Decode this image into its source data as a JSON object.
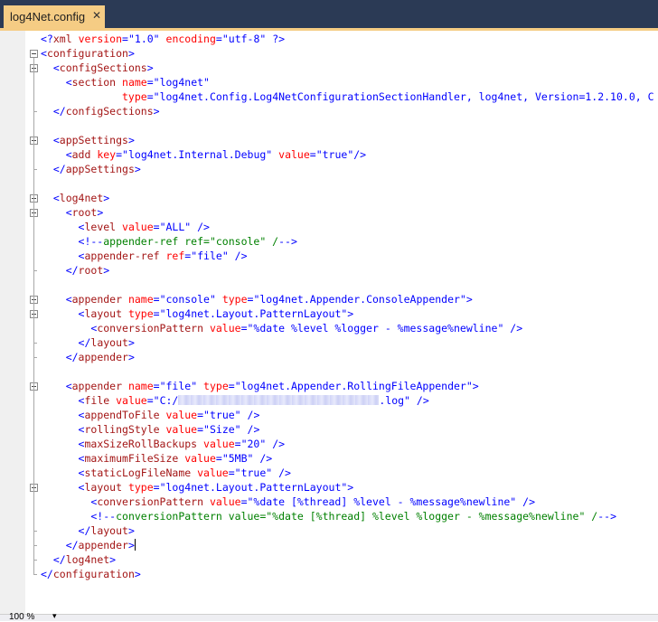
{
  "tab": {
    "title": "log4Net.config",
    "close_glyph": "✕"
  },
  "status": {
    "zoom": "100 %",
    "zoom_arrow": "▾"
  },
  "lines": [
    [
      [
        "b",
        "<?"
      ],
      [
        "t",
        "xml"
      ],
      [
        "a",
        " version"
      ],
      [
        "b",
        "="
      ],
      [
        "v",
        "\"1.0\""
      ],
      [
        "a",
        " encoding"
      ],
      [
        "b",
        "="
      ],
      [
        "v",
        "\"utf-8\""
      ],
      [
        "b",
        " ?>"
      ]
    ],
    [
      [
        "b",
        "<"
      ],
      [
        "t",
        "configuration"
      ],
      [
        "b",
        ">"
      ]
    ],
    [
      [
        "b",
        "  <"
      ],
      [
        "t",
        "configSections"
      ],
      [
        "b",
        ">"
      ]
    ],
    [
      [
        "b",
        "    <"
      ],
      [
        "t",
        "section"
      ],
      [
        "a",
        " name"
      ],
      [
        "b",
        "="
      ],
      [
        "v",
        "\"log4net\""
      ]
    ],
    [
      [
        "a",
        "             type"
      ],
      [
        "b",
        "="
      ],
      [
        "v",
        "\"log4net.Config.Log4NetConfigurationSectionHandler, log4net, Version=1.2.10.0, C"
      ]
    ],
    [
      [
        "b",
        "  </"
      ],
      [
        "t",
        "configSections"
      ],
      [
        "b",
        ">"
      ]
    ],
    [],
    [
      [
        "b",
        "  <"
      ],
      [
        "t",
        "appSettings"
      ],
      [
        "b",
        ">"
      ]
    ],
    [
      [
        "b",
        "    <"
      ],
      [
        "t",
        "add"
      ],
      [
        "a",
        " key"
      ],
      [
        "b",
        "="
      ],
      [
        "v",
        "\"log4net.Internal.Debug\""
      ],
      [
        "a",
        " value"
      ],
      [
        "b",
        "="
      ],
      [
        "v",
        "\"true\""
      ],
      [
        "b",
        "/>"
      ]
    ],
    [
      [
        "b",
        "  </"
      ],
      [
        "t",
        "appSettings"
      ],
      [
        "b",
        ">"
      ]
    ],
    [],
    [
      [
        "b",
        "  <"
      ],
      [
        "t",
        "log4net"
      ],
      [
        "b",
        ">"
      ]
    ],
    [
      [
        "b",
        "    <"
      ],
      [
        "t",
        "root"
      ],
      [
        "b",
        ">"
      ]
    ],
    [
      [
        "b",
        "      <"
      ],
      [
        "t",
        "level"
      ],
      [
        "a",
        " value"
      ],
      [
        "b",
        "="
      ],
      [
        "v",
        "\"ALL\""
      ],
      [
        "b",
        " />"
      ]
    ],
    [
      [
        "b",
        "      <!--"
      ],
      [
        "c",
        "appender-ref ref=\"console\" /"
      ],
      [
        "b",
        "-->"
      ]
    ],
    [
      [
        "b",
        "      <"
      ],
      [
        "t",
        "appender-ref"
      ],
      [
        "a",
        " ref"
      ],
      [
        "b",
        "="
      ],
      [
        "v",
        "\"file\""
      ],
      [
        "b",
        " />"
      ]
    ],
    [
      [
        "b",
        "    </"
      ],
      [
        "t",
        "root"
      ],
      [
        "b",
        ">"
      ]
    ],
    [],
    [
      [
        "b",
        "    <"
      ],
      [
        "t",
        "appender"
      ],
      [
        "a",
        " name"
      ],
      [
        "b",
        "="
      ],
      [
        "v",
        "\"console\""
      ],
      [
        "a",
        " type"
      ],
      [
        "b",
        "="
      ],
      [
        "v",
        "\"log4net.Appender.ConsoleAppender\""
      ],
      [
        "b",
        ">"
      ]
    ],
    [
      [
        "b",
        "      <"
      ],
      [
        "t",
        "layout"
      ],
      [
        "a",
        " type"
      ],
      [
        "b",
        "="
      ],
      [
        "v",
        "\"log4net.Layout.PatternLayout\""
      ],
      [
        "b",
        ">"
      ]
    ],
    [
      [
        "b",
        "        <"
      ],
      [
        "t",
        "conversionPattern"
      ],
      [
        "a",
        " value"
      ],
      [
        "b",
        "="
      ],
      [
        "v",
        "\"%date %level %logger - %message%newline\""
      ],
      [
        "b",
        " />"
      ]
    ],
    [
      [
        "b",
        "      </"
      ],
      [
        "t",
        "layout"
      ],
      [
        "b",
        ">"
      ]
    ],
    [
      [
        "b",
        "    </"
      ],
      [
        "t",
        "appender"
      ],
      [
        "b",
        ">"
      ]
    ],
    [],
    [
      [
        "b",
        "    <"
      ],
      [
        "t",
        "appender"
      ],
      [
        "a",
        " name"
      ],
      [
        "b",
        "="
      ],
      [
        "v",
        "\"file\""
      ],
      [
        "a",
        " type"
      ],
      [
        "b",
        "="
      ],
      [
        "v",
        "\"log4net.Appender.RollingFileAppender\""
      ],
      [
        "b",
        ">"
      ]
    ],
    [
      [
        "b",
        "      <"
      ],
      [
        "t",
        "file"
      ],
      [
        "a",
        " value"
      ],
      [
        "b",
        "="
      ],
      [
        "v",
        "\"C:/"
      ],
      [
        "blur",
        ""
      ],
      [
        "v",
        ".log\""
      ],
      [
        "b",
        " />"
      ]
    ],
    [
      [
        "b",
        "      <"
      ],
      [
        "t",
        "appendToFile"
      ],
      [
        "a",
        " value"
      ],
      [
        "b",
        "="
      ],
      [
        "v",
        "\"true\""
      ],
      [
        "b",
        " />"
      ]
    ],
    [
      [
        "b",
        "      <"
      ],
      [
        "t",
        "rollingStyle"
      ],
      [
        "a",
        " value"
      ],
      [
        "b",
        "="
      ],
      [
        "v",
        "\"Size\""
      ],
      [
        "b",
        " />"
      ]
    ],
    [
      [
        "b",
        "      <"
      ],
      [
        "t",
        "maxSizeRollBackups"
      ],
      [
        "a",
        " value"
      ],
      [
        "b",
        "="
      ],
      [
        "v",
        "\"20\""
      ],
      [
        "b",
        " />"
      ]
    ],
    [
      [
        "b",
        "      <"
      ],
      [
        "t",
        "maximumFileSize"
      ],
      [
        "a",
        " value"
      ],
      [
        "b",
        "="
      ],
      [
        "v",
        "\"5MB\""
      ],
      [
        "b",
        " />"
      ]
    ],
    [
      [
        "b",
        "      <"
      ],
      [
        "t",
        "staticLogFileName"
      ],
      [
        "a",
        " value"
      ],
      [
        "b",
        "="
      ],
      [
        "v",
        "\"true\""
      ],
      [
        "b",
        " />"
      ]
    ],
    [
      [
        "b",
        "      <"
      ],
      [
        "t",
        "layout"
      ],
      [
        "a",
        " type"
      ],
      [
        "b",
        "="
      ],
      [
        "v",
        "\"log4net.Layout.PatternLayout\""
      ],
      [
        "b",
        ">"
      ]
    ],
    [
      [
        "b",
        "        <"
      ],
      [
        "t",
        "conversionPattern"
      ],
      [
        "a",
        " value"
      ],
      [
        "b",
        "="
      ],
      [
        "v",
        "\"%date [%thread] %level - %message%newline\""
      ],
      [
        "b",
        " />"
      ]
    ],
    [
      [
        "b",
        "        <!--"
      ],
      [
        "c",
        "conversionPattern value=\"%date [%thread] %level %logger - %message%newline\" /"
      ],
      [
        "b",
        "-->"
      ]
    ],
    [
      [
        "b",
        "      </"
      ],
      [
        "t",
        "layout"
      ],
      [
        "b",
        ">"
      ]
    ],
    [
      [
        "b",
        "    </"
      ],
      [
        "t",
        "appender"
      ],
      [
        "b",
        ">"
      ],
      [
        "caret",
        ""
      ]
    ],
    [
      [
        "b",
        "  </"
      ],
      [
        "t",
        "log4net"
      ],
      [
        "b",
        ">"
      ]
    ],
    [
      [
        "b",
        "</"
      ],
      [
        "t",
        "configuration"
      ],
      [
        "b",
        ">"
      ]
    ]
  ]
}
